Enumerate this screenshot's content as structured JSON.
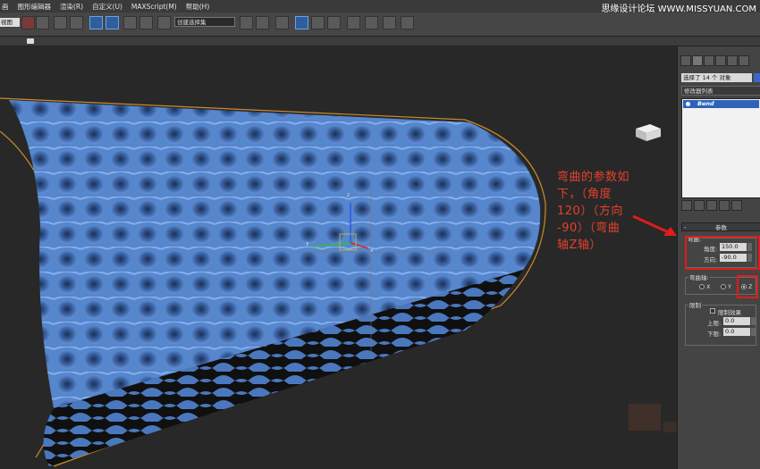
{
  "menubar": {
    "items": [
      "画",
      "图形编辑器",
      "渲染(R)",
      "自定义(U)",
      "MAXScript(M)",
      "帮助(H)"
    ],
    "watermark": "思缘设计论坛  WWW.MISSYUAN.COM"
  },
  "toolbar": {
    "view_combo": "视图",
    "selection_set": "创建选择集"
  },
  "annotation": {
    "lines": [
      "弯曲的参数如",
      "下，（角度",
      "120）（方向",
      "-90）（弯曲",
      "轴Z轴）"
    ]
  },
  "command_panel": {
    "object_field": "选择了 14 个 对象",
    "modifier_list": "修改器列表",
    "stack_item": "Bend",
    "rollout_title": "参数",
    "bend_group": {
      "label": "弯曲:",
      "angle_label": "角度:",
      "angle_value": "150.0",
      "direction_label": "方向:",
      "direction_value": "-90.0"
    },
    "axis_group": {
      "label": "弯曲轴:",
      "options": [
        "X",
        "Y",
        "Z"
      ],
      "selected": "Z"
    },
    "limits_group": {
      "label": "限制",
      "limit_effect": "限制效果",
      "upper_label": "上限:",
      "upper_value": "0.0",
      "lower_label": "下限:",
      "lower_value": "0.0"
    }
  },
  "colors": {
    "mesh": "#4f7fc3",
    "annotation": "#e8402c",
    "highlight": "#e21b1b",
    "stack_selected": "#2d63b8"
  }
}
